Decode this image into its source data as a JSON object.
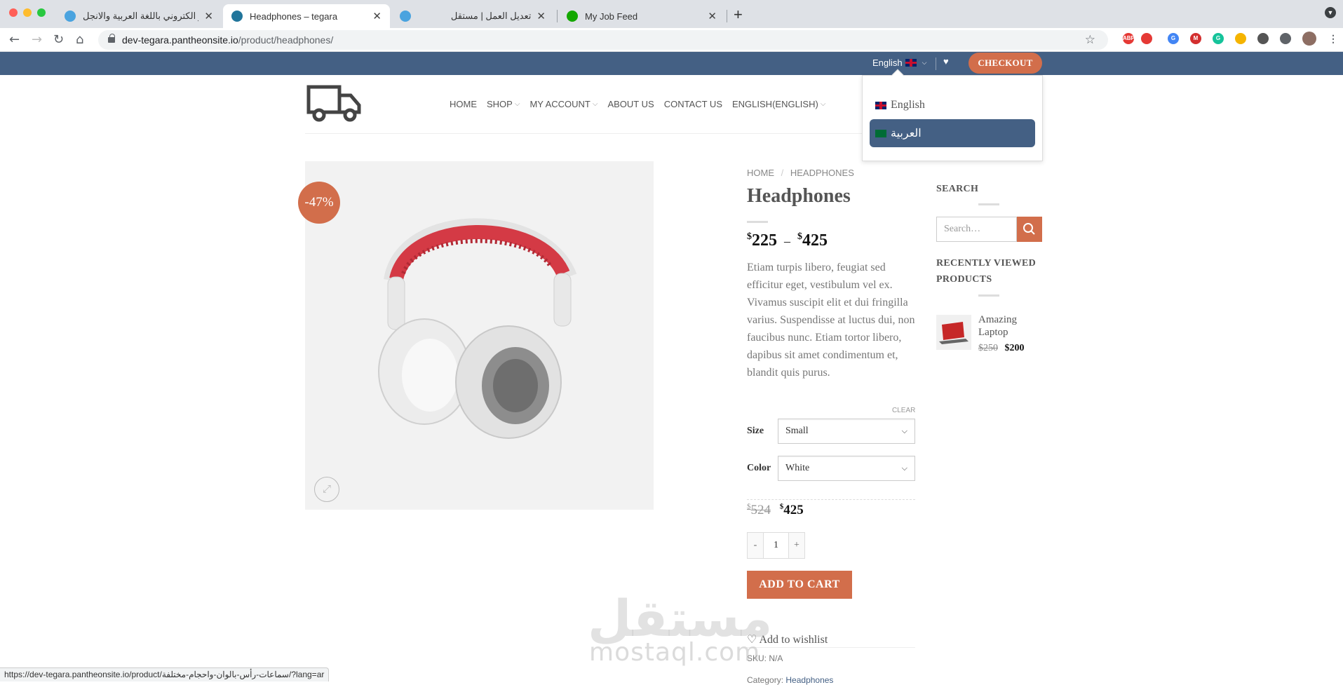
{
  "browser": {
    "tabs": [
      {
        "label": "متجر الكتروني باللغة العربية والانجل...",
        "active": false
      },
      {
        "label": "Headphones – tegara",
        "active": true
      },
      {
        "label": "تعديل العمل | مستقل",
        "active": false
      },
      {
        "label": "My Job Feed",
        "active": false
      }
    ],
    "url_host": "dev-tegara.pantheonsite.io",
    "url_path": "/product/headphones/",
    "status_url": "https://dev-tegara.pantheonsite.io/product/سماعات-رأس-بالوان-واحجام-مختلفة/?lang=ar"
  },
  "topbar": {
    "language": "English",
    "checkout": "CHECKOUT"
  },
  "nav": [
    {
      "label": "HOME",
      "dropdown": false
    },
    {
      "label": "SHOP",
      "dropdown": true
    },
    {
      "label": "MY ACCOUNT",
      "dropdown": true
    },
    {
      "label": "ABOUT US",
      "dropdown": false
    },
    {
      "label": "CONTACT US",
      "dropdown": false
    },
    {
      "label": "ENGLISH(ENGLISH)",
      "dropdown": true
    }
  ],
  "lang_dropdown": {
    "english": "English",
    "arabic": "العربية"
  },
  "product": {
    "sale_badge": "-47%",
    "breadcrumb_home": "HOME",
    "breadcrumb_sep": "/",
    "breadcrumb_current": "HEADPHONES",
    "title": "Headphones",
    "price_min": "225",
    "price_max": "425",
    "price_sep": "–",
    "currency": "$",
    "description": "Etiam turpis libero, feugiat sed efficitur eget, vestibulum vel ex. Vivamus suscipit elit et dui fringilla varius. Suspendisse at luctus dui, non faucibus nunc. Etiam tortor libero, dapibus sit amet condimentum et, blandit quis purus.",
    "clear": "CLEAR",
    "size_label": "Size",
    "size_value": "Small",
    "color_label": "Color",
    "color_value": "White",
    "old_price": "524",
    "new_price": "425",
    "qty_minus": "-",
    "qty_value": "1",
    "qty_plus": "+",
    "add_to_cart": "ADD TO CART",
    "wishlist": "Add to wishlist",
    "sku": "SKU: N/A",
    "category_label": "Category:",
    "category": "Headphones"
  },
  "sidebar": {
    "search_title": "SEARCH",
    "search_placeholder": "Search…",
    "recent_title": "RECENTLY VIEWED PRODUCTS",
    "recent_items": [
      {
        "name": "Amazing Laptop",
        "old_price": "$250",
        "new_price": "$200"
      }
    ]
  },
  "watermark": {
    "arabic": "مستقل",
    "latin": "mostaql.com"
  },
  "colors": {
    "primary": "#446084",
    "accent": "#d26e4b"
  }
}
